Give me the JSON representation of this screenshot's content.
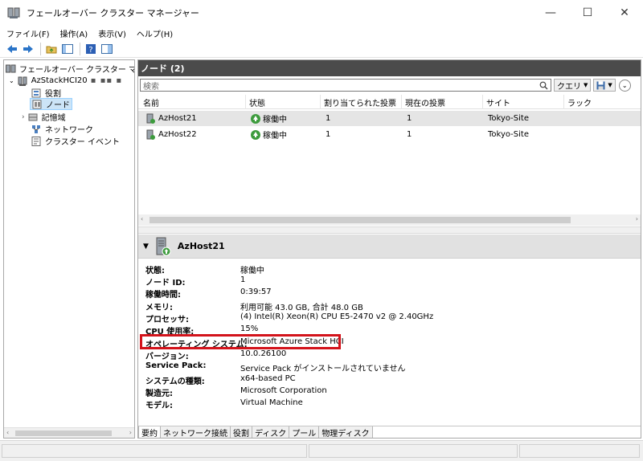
{
  "window": {
    "title": "フェールオーバー クラスター マネージャー",
    "minimize": "—",
    "maximize": "☐",
    "close": "✕"
  },
  "menu": [
    "ファイル(F)",
    "操作(A)",
    "表示(V)",
    "ヘルプ(H)"
  ],
  "tree": {
    "root": "フェールオーバー クラスター マネージャ",
    "cluster": "AzStackHCI20",
    "items": [
      "役割",
      "ノード",
      "記憶域",
      "ネットワーク",
      "クラスター イベント"
    ],
    "selected": "ノード"
  },
  "pane": {
    "title": "ノード (2)",
    "search_placeholder": "検索",
    "query_label": "クエリ",
    "columns": [
      "名前",
      "状態",
      "割り当てられた投票",
      "現在の投票",
      "サイト",
      "ラック"
    ],
    "rows": [
      {
        "name": "AzHost21",
        "status": "稼働中",
        "assigned_votes": "1",
        "current_votes": "1",
        "site": "Tokyo-Site",
        "rack": ""
      },
      {
        "name": "AzHost22",
        "status": "稼働中",
        "assigned_votes": "1",
        "current_votes": "1",
        "site": "Tokyo-Site",
        "rack": ""
      }
    ]
  },
  "detail": {
    "name": "AzHost21",
    "properties": [
      {
        "key": "状態:",
        "value": "稼働中"
      },
      {
        "key": "ノード ID:",
        "value": "1"
      },
      {
        "key": "稼働時間:",
        "value": "0:39:57"
      },
      {
        "key": "メモリ:",
        "value": "利用可能 43.0 GB, 合計 48.0 GB"
      },
      {
        "key": "プロセッサ:",
        "value": "(4) Intel(R) Xeon(R) CPU E5-2470 v2 @ 2.40GHz"
      },
      {
        "key": "CPU 使用率:",
        "value": "15%"
      },
      {
        "key": "オペレーティング システム:",
        "value": "Microsoft Azure Stack HCI"
      },
      {
        "key": "バージョン:",
        "value": "10.0.26100"
      },
      {
        "key": "Service Pack:",
        "value": "Service Pack がインストールされていません"
      },
      {
        "key": "システムの種類:",
        "value": "x64-based PC"
      },
      {
        "key": "製造元:",
        "value": "Microsoft Corporation"
      },
      {
        "key": "モデル:",
        "value": "Virtual Machine"
      }
    ],
    "tabs": [
      "要約",
      "ネットワーク接続",
      "役割",
      "ディスク",
      "プール",
      "物理ディスク"
    ],
    "active_tab": "要約"
  },
  "colors": {
    "header_bg": "#4b4b4b",
    "highlight": "#d3131b",
    "status_ok": "#3d9b3d"
  }
}
